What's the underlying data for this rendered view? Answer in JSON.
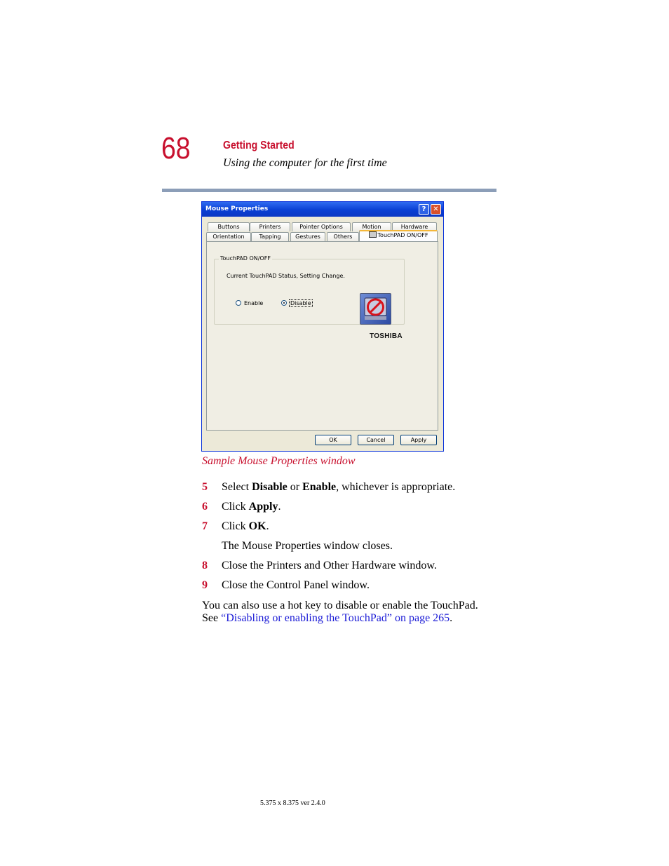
{
  "header": {
    "page_number": "68",
    "chapter": "Getting Started",
    "section": "Using the computer for the first time"
  },
  "dialog": {
    "title": "Mouse Properties",
    "help_glyph": "?",
    "close_glyph": "✕",
    "tabs_row1": [
      "Buttons",
      "Printers",
      "Pointer Options",
      "Motion",
      "Hardware"
    ],
    "tabs_row2": [
      "Orientation",
      "Tapping",
      "Gestures",
      "Others",
      "TouchPAD ON/OFF"
    ],
    "group_label": "TouchPAD ON/OFF",
    "status_text": "Current TouchPAD Status, Setting Change.",
    "radio_enable": "Enable",
    "radio_disable": "Disable",
    "selected": "Disable",
    "brand": "TOSHIBA",
    "buttons": {
      "ok": "OK",
      "cancel": "Cancel",
      "apply": "Apply"
    }
  },
  "caption": "Sample Mouse Properties window",
  "steps": [
    {
      "num": "5",
      "pre": "Select ",
      "b1": "Disable",
      "mid": " or ",
      "b2": "Enable",
      "post": ", whichever is appropriate."
    },
    {
      "num": "6",
      "pre": "Click ",
      "b1": "Apply",
      "post": "."
    },
    {
      "num": "7",
      "pre": "Click ",
      "b1": "OK",
      "post": "."
    },
    {
      "note": "The Mouse Properties window closes."
    },
    {
      "num": "8",
      "text": "Close the Printers and Other Hardware window."
    },
    {
      "num": "9",
      "text": "Close the Control Panel window."
    }
  ],
  "paragraph": {
    "line1": "You can also use a hot key to disable or enable the TouchPad.",
    "see": "See ",
    "link": "“Disabling or enabling the TouchPad” on page 265",
    "end": "."
  },
  "footer": "5.375 x 8.375 ver 2.4.0",
  "colors": {
    "accent_red": "#c8102e",
    "link_blue": "#1a1ad6",
    "rule": "#8c9eb8"
  }
}
